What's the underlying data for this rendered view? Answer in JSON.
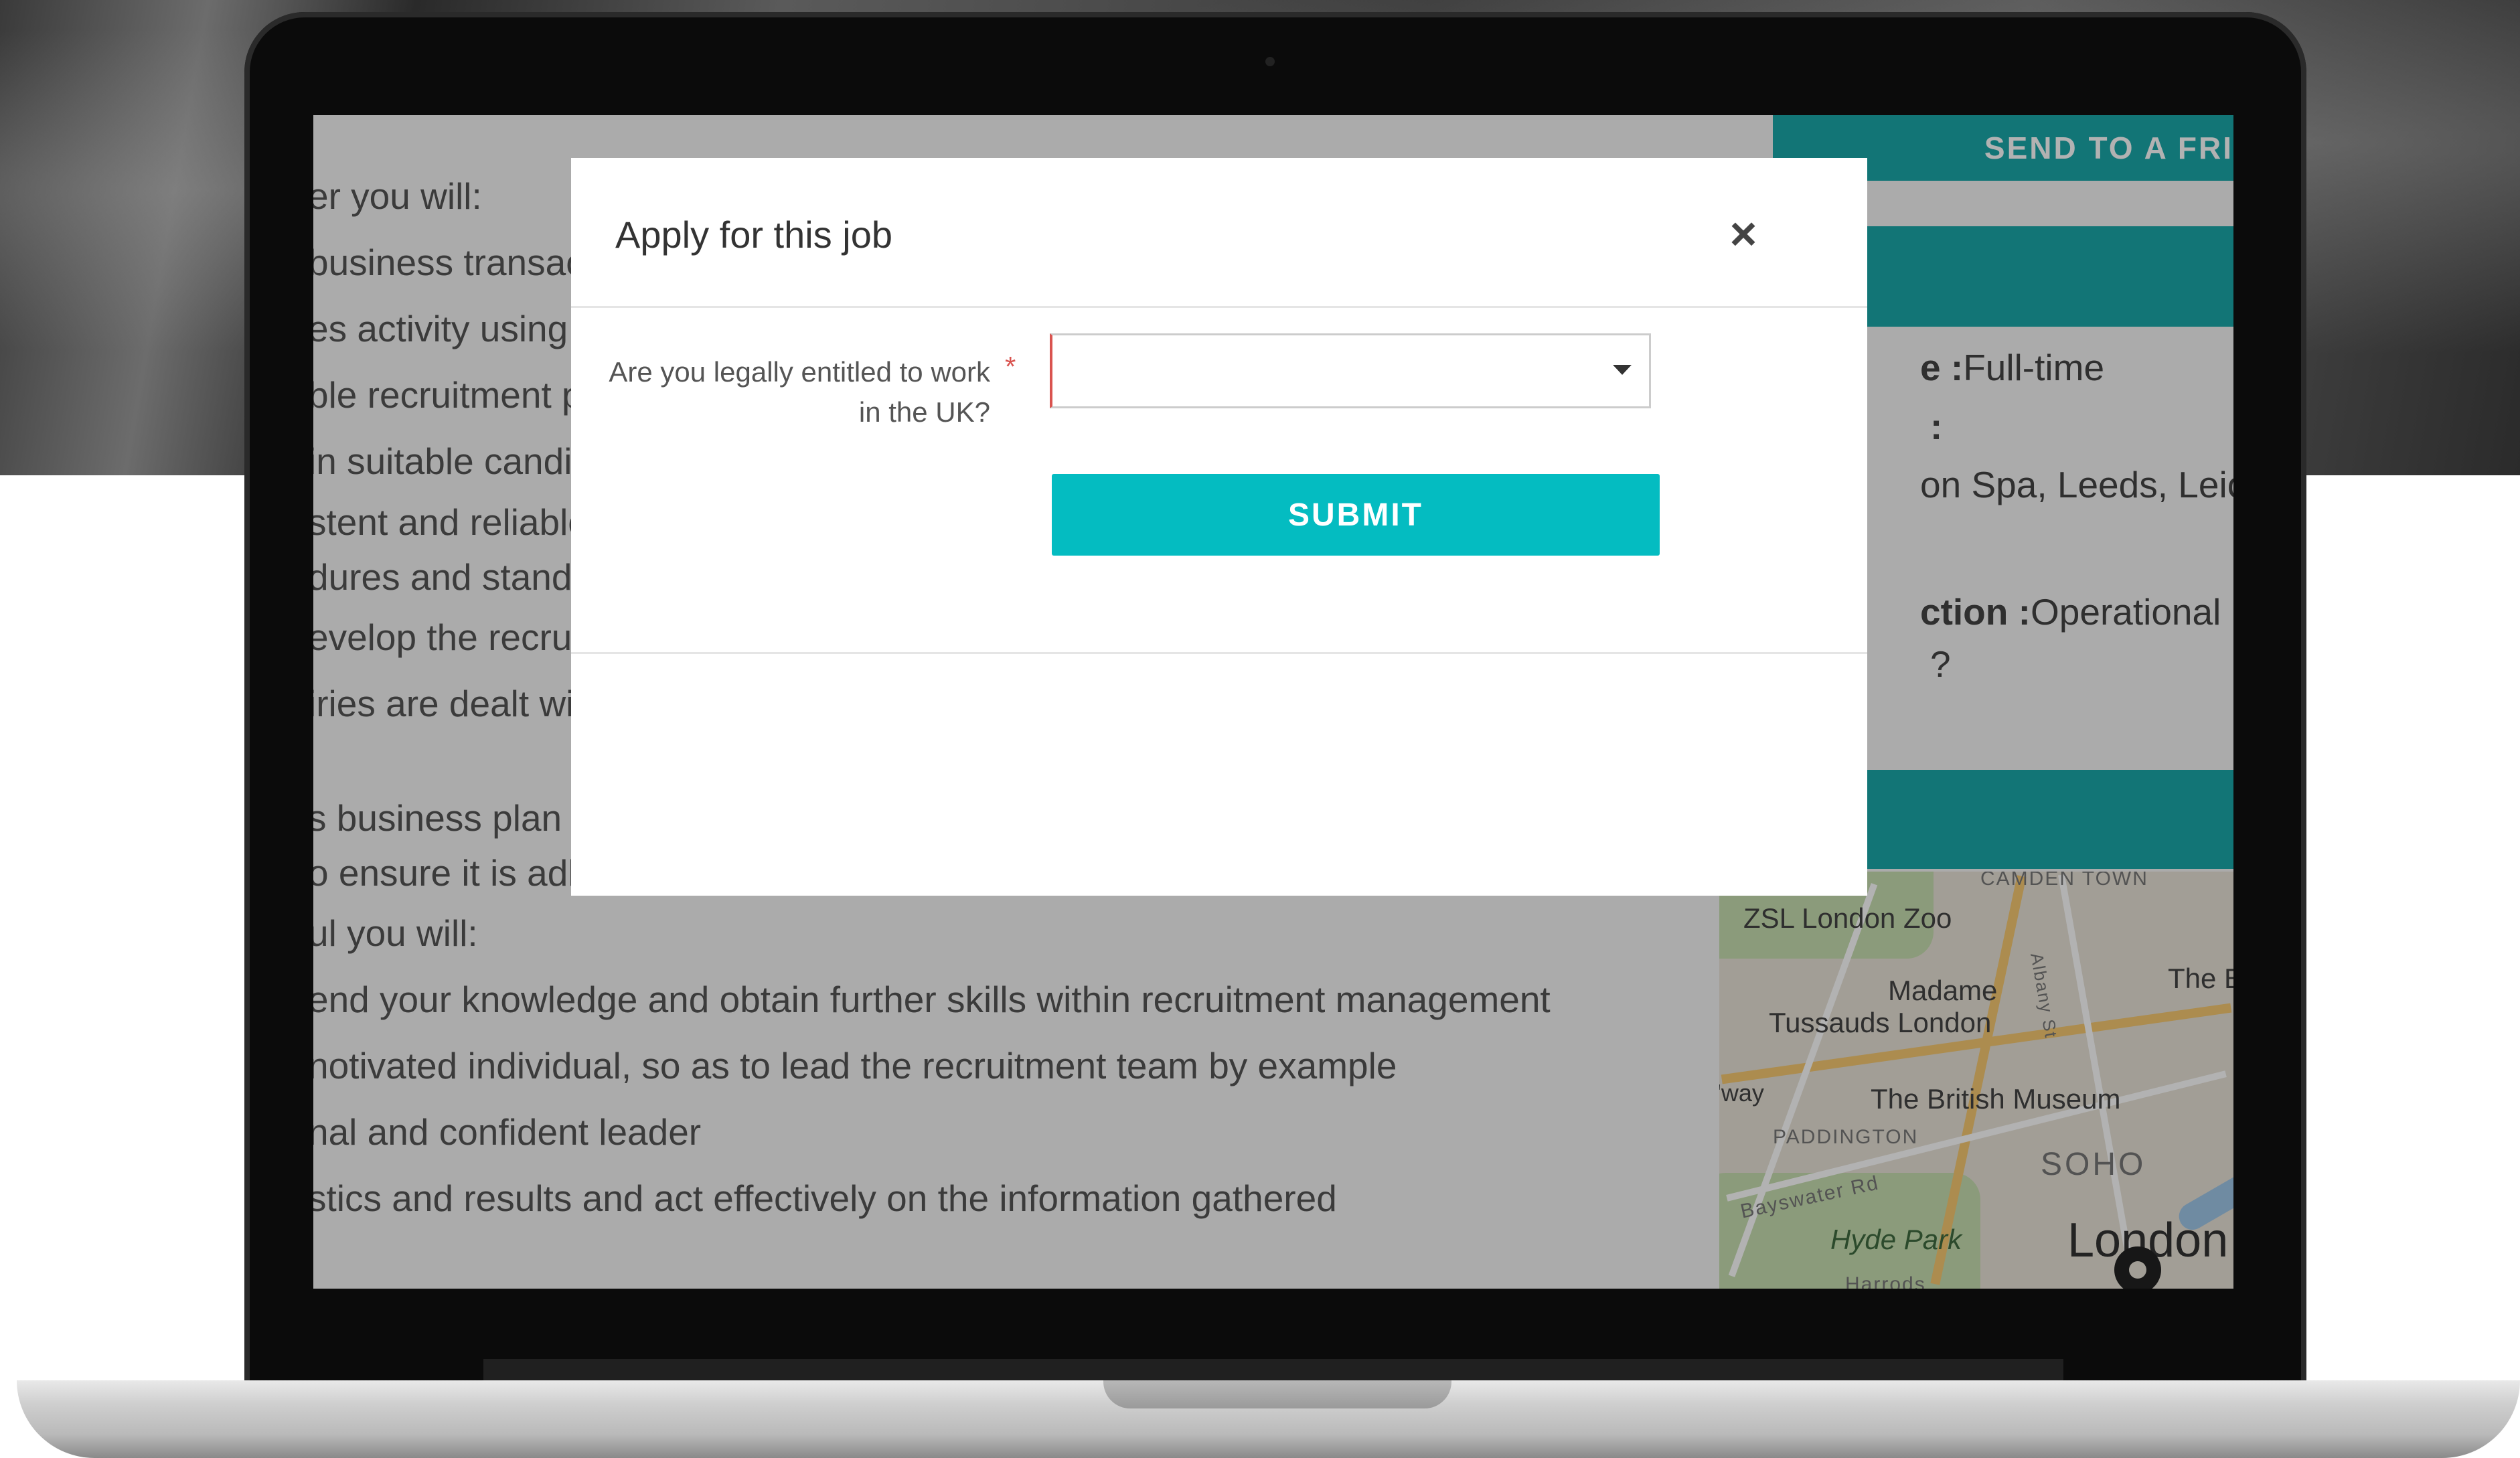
{
  "modal": {
    "title": "Apply for this job",
    "close_label": "×",
    "question": "Are you legally entitled to work in the UK?",
    "required_marker": "*",
    "select_value": "",
    "submit_label": "SUBMIT"
  },
  "job_description": {
    "lines": [
      "er you will:",
      "business transac",
      "es activity using t",
      "ble recruitment p",
      "in suitable candi",
      "stent and reliable",
      "dures and standa",
      "evelop the recruit",
      "iries are dealt wi",
      "s business plan t",
      "o ensure it is adhered to",
      "ul you will:",
      "end your knowledge and obtain further skills within recruitment management",
      "notivated individual, so as to lead the recruitment team by example",
      "nal and confident leader",
      "stics and results and act effectively on the information gathered"
    ]
  },
  "sidebar": {
    "send_button": "SEND TO A FRI",
    "employment_type_label": "e :",
    "employment_type_value": "Full-time",
    "locations_label": ":",
    "locations_value": "on Spa, Leeds, Leic",
    "function_label": "ction :",
    "function_value": "Operational M",
    "extra_char": "?"
  },
  "map": {
    "labels": {
      "camden": "CAMDEN TOWN",
      "zoo": "ZSL London Zoo",
      "madame": "Madame",
      "tussauds": "Tussauds London",
      "museum": "The British Museum",
      "paddington": "PADDINGTON",
      "soho": "SOHO",
      "bayswater": "Bayswater Rd",
      "hyde_park": "Hyde Park",
      "london": "London",
      "albany": "Albany St",
      "the_b": "The B",
      "way": "'way",
      "harrods": "Harrods"
    }
  }
}
